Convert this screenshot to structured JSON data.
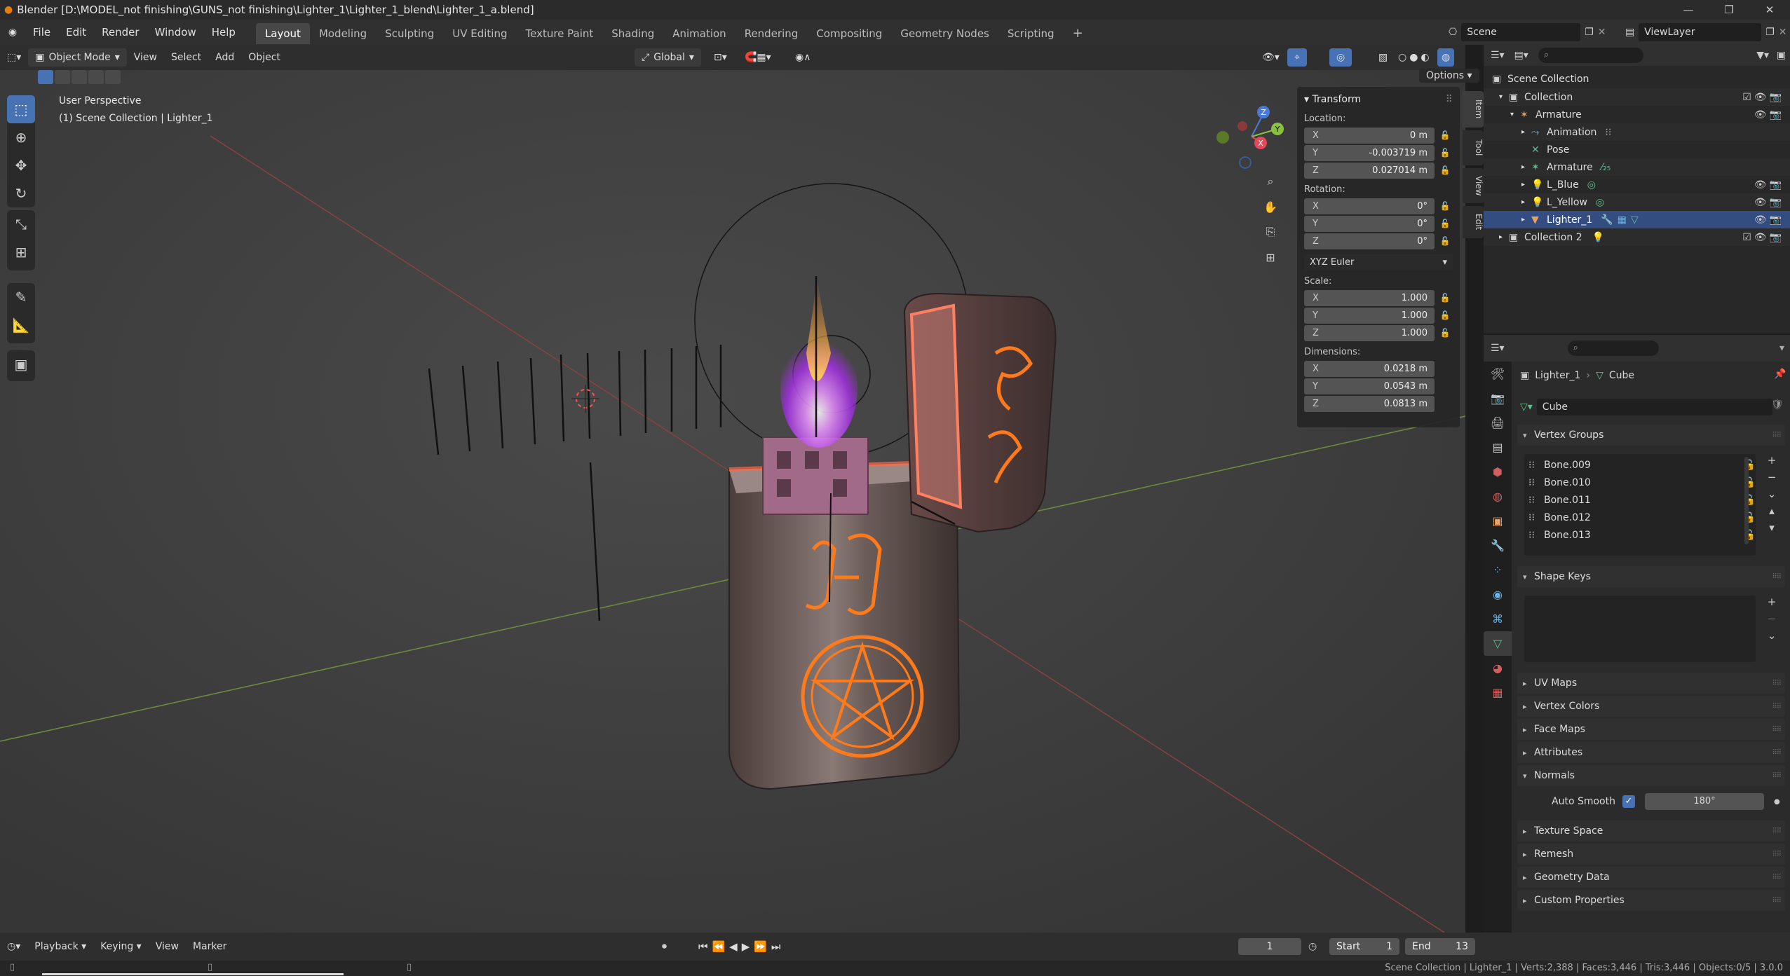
{
  "window": {
    "title": "Blender [D:\\MODEL_not finishing\\GUNS_not finishing\\Lighter_1\\Lighter_1_blend\\Lighter_1_a.blend]",
    "controls": [
      "—",
      "❐",
      "✕"
    ]
  },
  "menu": [
    "File",
    "Edit",
    "Render",
    "Window",
    "Help"
  ],
  "workspaces": [
    "Layout",
    "Modeling",
    "Sculpting",
    "UV Editing",
    "Texture Paint",
    "Shading",
    "Animation",
    "Rendering",
    "Compositing",
    "Geometry Nodes",
    "Scripting"
  ],
  "active_workspace": "Layout",
  "scene_name": "Scene",
  "view_layer": "ViewLayer",
  "viewport": {
    "mode": "Object Mode",
    "menus": [
      "View",
      "Select",
      "Add",
      "Object"
    ],
    "transform_orientation": "Global",
    "options_label": "Options",
    "perspective": "User Perspective",
    "collection_info": "(1) Scene Collection | Lighter_1",
    "gizmo_axes": [
      "X",
      "Y",
      "Z"
    ]
  },
  "n_panel": {
    "title": "Transform",
    "location_label": "Location:",
    "location": [
      {
        "axis": "X",
        "value": "0 m"
      },
      {
        "axis": "Y",
        "value": "-0.003719 m"
      },
      {
        "axis": "Z",
        "value": "0.027014 m"
      }
    ],
    "rotation_label": "Rotation:",
    "rotation": [
      {
        "axis": "X",
        "value": "0°"
      },
      {
        "axis": "Y",
        "value": "0°"
      },
      {
        "axis": "Z",
        "value": "0°"
      }
    ],
    "rotation_mode": "XYZ Euler",
    "scale_label": "Scale:",
    "scale": [
      {
        "axis": "X",
        "value": "1.000"
      },
      {
        "axis": "Y",
        "value": "1.000"
      },
      {
        "axis": "Z",
        "value": "1.000"
      }
    ],
    "dimensions_label": "Dimensions:",
    "dimensions": [
      {
        "axis": "X",
        "value": "0.0218 m"
      },
      {
        "axis": "Y",
        "value": "0.0543 m"
      },
      {
        "axis": "Z",
        "value": "0.0813 m"
      }
    ],
    "side_tabs": [
      "Item",
      "Tool",
      "View",
      "Edit"
    ]
  },
  "outliner": {
    "root": "Scene Collection",
    "items": [
      {
        "label": "Collection"
      },
      {
        "label": "Armature"
      },
      {
        "label": "Animation"
      },
      {
        "label": "Pose"
      },
      {
        "label": "Armature"
      },
      {
        "label": "L_Blue"
      },
      {
        "label": "L_Yellow"
      },
      {
        "label": "Lighter_1"
      },
      {
        "label": "Collection 2"
      }
    ]
  },
  "properties": {
    "breadcrumb_object": "Lighter_1",
    "breadcrumb_data": "Cube",
    "mesh_name": "Cube",
    "vertex_groups_label": "Vertex Groups",
    "vertex_groups": [
      "Bone.009",
      "Bone.010",
      "Bone.011",
      "Bone.012",
      "Bone.013"
    ],
    "shape_keys_label": "Shape Keys",
    "sections": [
      "UV Maps",
      "Vertex Colors",
      "Face Maps",
      "Attributes"
    ],
    "normals_label": "Normals",
    "auto_smooth_label": "Auto Smooth",
    "auto_smooth_angle": "180°",
    "more_sections": [
      "Texture Space",
      "Remesh",
      "Geometry Data",
      "Custom Properties"
    ]
  },
  "timeline": {
    "menus": [
      "Playback",
      "Keying",
      "View",
      "Marker"
    ],
    "current_frame": "1",
    "start_label": "Start",
    "start": "1",
    "end_label": "End",
    "end": "13"
  },
  "status": "Scene Collection | Lighter_1 | Verts:2,388 | Faces:3,446 | Tris:3,446 | Objects:0/5 | 3.0.0",
  "colors": {
    "accent": "#4772b3",
    "glow": "#ff7a1a",
    "selected_row": "#334d80"
  }
}
